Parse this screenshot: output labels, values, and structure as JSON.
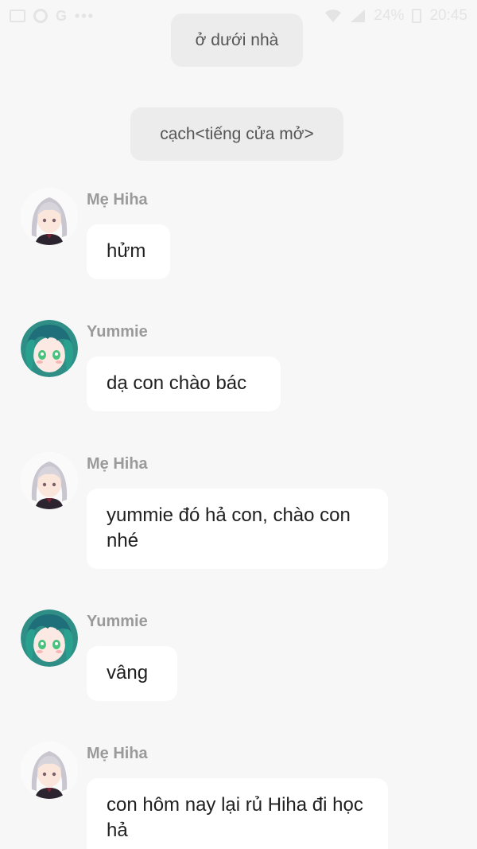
{
  "status_bar": {
    "left_icons": [
      "image-icon",
      "whatsapp-icon",
      "google-icon",
      "more-icon"
    ],
    "battery_text": "24%",
    "time": "20:45"
  },
  "notices": [
    {
      "text": "ở dưới nhà"
    },
    {
      "text": "cạch<tiếng cửa mở>"
    }
  ],
  "messages": [
    {
      "sender": "Mẹ Hiha",
      "text": "hửm",
      "avatar": "silver-hair-avatar"
    },
    {
      "sender": "Yummie",
      "text": "dạ con chào bác",
      "avatar": "green-hair-avatar"
    },
    {
      "sender": "Mẹ Hiha",
      "text": "yummie đó hả con, chào con nhé",
      "avatar": "silver-hair-avatar"
    },
    {
      "sender": "Yummie",
      "text": "vâng",
      "avatar": "green-hair-avatar"
    },
    {
      "sender": "Mẹ Hiha",
      "text": "con hôm nay lại rủ Hiha đi học hả",
      "avatar": "silver-hair-avatar"
    }
  ]
}
